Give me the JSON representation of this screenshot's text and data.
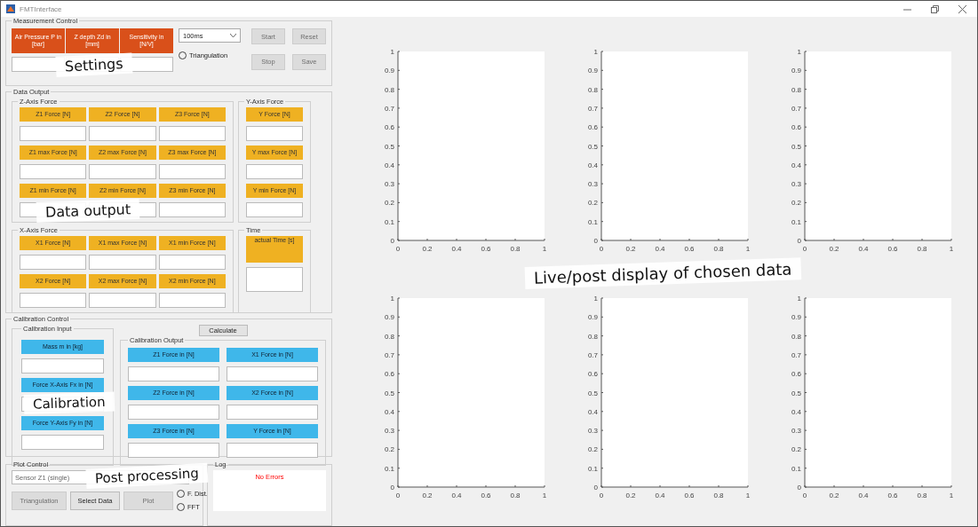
{
  "window": {
    "title": "FMTInterface"
  },
  "measurement_control": {
    "title": "Measurement Control",
    "settings": [
      {
        "label": "Air Pressure P in [bar]"
      },
      {
        "label": "Z depth Zd in [mm]"
      },
      {
        "label": "Sensitivity in [N/V]"
      }
    ],
    "interval": {
      "value": "100ms"
    },
    "triangulation": {
      "label": "Triangulation",
      "selected": false
    },
    "buttons": [
      {
        "label": "Start",
        "disabled": true
      },
      {
        "label": "Reset",
        "disabled": true
      },
      {
        "label": "Stop",
        "disabled": true
      },
      {
        "label": "Save",
        "disabled": true
      }
    ]
  },
  "data_output": {
    "title": "Data Output",
    "groups": [
      {
        "title": "Z-Axis Force",
        "fields": [
          {
            "label": "Z1 Force [N]"
          },
          {
            "label": "Z2 Force [N]"
          },
          {
            "label": "Z3 Force [N]"
          },
          {
            "label": "Z1 max Force [N]"
          },
          {
            "label": "Z2 max Force [N]"
          },
          {
            "label": "Z3 max Force [N]"
          },
          {
            "label": "Z1 min Force [N]"
          },
          {
            "label": "Z2 min Force [N]"
          },
          {
            "label": "Z3 min Force [N]"
          }
        ]
      },
      {
        "title": "Y-Axis Force",
        "fields": [
          {
            "label": "Y Force [N]"
          },
          {
            "label": "Y max Force [N]"
          },
          {
            "label": "Y min Force [N]"
          }
        ]
      },
      {
        "title": "X-Axis Force",
        "fields": [
          {
            "label": "X1 Force [N]"
          },
          {
            "label": "X1 max Force [N]"
          },
          {
            "label": "X1 min Force [N]"
          },
          {
            "label": "X2 Force [N]"
          },
          {
            "label": "X2 max Force [N]"
          },
          {
            "label": "X2 min Force [N]"
          }
        ]
      },
      {
        "title": "Time",
        "fields": [
          {
            "label": "actual Time [s]"
          }
        ]
      }
    ]
  },
  "calibration_control": {
    "title": "Calibration Control",
    "input": {
      "title": "Calibration Input",
      "fields": [
        {
          "label": "Mass m in [kg]"
        },
        {
          "label": "Force X-Axis Fx in [N]"
        },
        {
          "label": "Force Y-Axis Fy in [N]"
        }
      ]
    },
    "calculate_button": {
      "label": "Calculate"
    },
    "output": {
      "title": "Calibration Output",
      "fields": [
        {
          "label": "Z1 Force in [N]"
        },
        {
          "label": "X1 Force in [N]"
        },
        {
          "label": "Z2 Force in [N]"
        },
        {
          "label": "X2 Force in [N]"
        },
        {
          "label": "Z3 Force in [N]"
        },
        {
          "label": "Y Force in [N]"
        }
      ]
    }
  },
  "plot_control": {
    "title": "Plot Control",
    "sensor": {
      "value": "Sensor Z1 (single)"
    },
    "buttons": [
      {
        "label": "Triangulation",
        "disabled": true
      },
      {
        "label": "Select Data",
        "disabled": false
      },
      {
        "label": "Plot",
        "disabled": true
      }
    ],
    "options": [
      {
        "label": "F. Dist.",
        "selected": false
      },
      {
        "label": "FFT",
        "selected": false
      }
    ]
  },
  "log": {
    "title": "Log",
    "message": "No Errors"
  },
  "plots": [
    {
      "chart_data": {
        "type": "line",
        "xlim": [
          0,
          1
        ],
        "ylim": [
          0,
          1
        ],
        "xticks": [
          0,
          0.2,
          0.4,
          0.6,
          0.8,
          1
        ],
        "yticks": [
          0,
          0.1,
          0.2,
          0.3,
          0.4,
          0.5,
          0.6,
          0.7,
          0.8,
          0.9,
          1
        ]
      }
    },
    {
      "chart_data": {
        "type": "line",
        "xlim": [
          0,
          1
        ],
        "ylim": [
          0,
          1
        ],
        "xticks": [
          0,
          0.2,
          0.4,
          0.6,
          0.8,
          1
        ],
        "yticks": [
          0,
          0.1,
          0.2,
          0.3,
          0.4,
          0.5,
          0.6,
          0.7,
          0.8,
          0.9,
          1
        ]
      }
    },
    {
      "chart_data": {
        "type": "line",
        "xlim": [
          0,
          1
        ],
        "ylim": [
          0,
          1
        ],
        "xticks": [
          0,
          0.2,
          0.4,
          0.6,
          0.8,
          1
        ],
        "yticks": [
          0,
          0.1,
          0.2,
          0.3,
          0.4,
          0.5,
          0.6,
          0.7,
          0.8,
          0.9,
          1
        ]
      }
    },
    {
      "chart_data": {
        "type": "line",
        "xlim": [
          0,
          1
        ],
        "ylim": [
          0,
          1
        ],
        "xticks": [
          0,
          0.2,
          0.4,
          0.6,
          0.8,
          1
        ],
        "yticks": [
          0,
          0.1,
          0.2,
          0.3,
          0.4,
          0.5,
          0.6,
          0.7,
          0.8,
          0.9,
          1
        ]
      }
    },
    {
      "chart_data": {
        "type": "line",
        "xlim": [
          0,
          1
        ],
        "ylim": [
          0,
          1
        ],
        "xticks": [
          0,
          0.2,
          0.4,
          0.6,
          0.8,
          1
        ],
        "yticks": [
          0,
          0.1,
          0.2,
          0.3,
          0.4,
          0.5,
          0.6,
          0.7,
          0.8,
          0.9,
          1
        ]
      }
    },
    {
      "chart_data": {
        "type": "line",
        "xlim": [
          0,
          1
        ],
        "ylim": [
          0,
          1
        ],
        "xticks": [
          0,
          0.2,
          0.4,
          0.6,
          0.8,
          1
        ],
        "yticks": [
          0,
          0.1,
          0.2,
          0.3,
          0.4,
          0.5,
          0.6,
          0.7,
          0.8,
          0.9,
          1
        ]
      }
    }
  ],
  "annotations": [
    {
      "text": "Settings"
    },
    {
      "text": "Data output"
    },
    {
      "text": "Calibration"
    },
    {
      "text": "Post processing"
    },
    {
      "text": "Live/post display of chosen data"
    }
  ]
}
